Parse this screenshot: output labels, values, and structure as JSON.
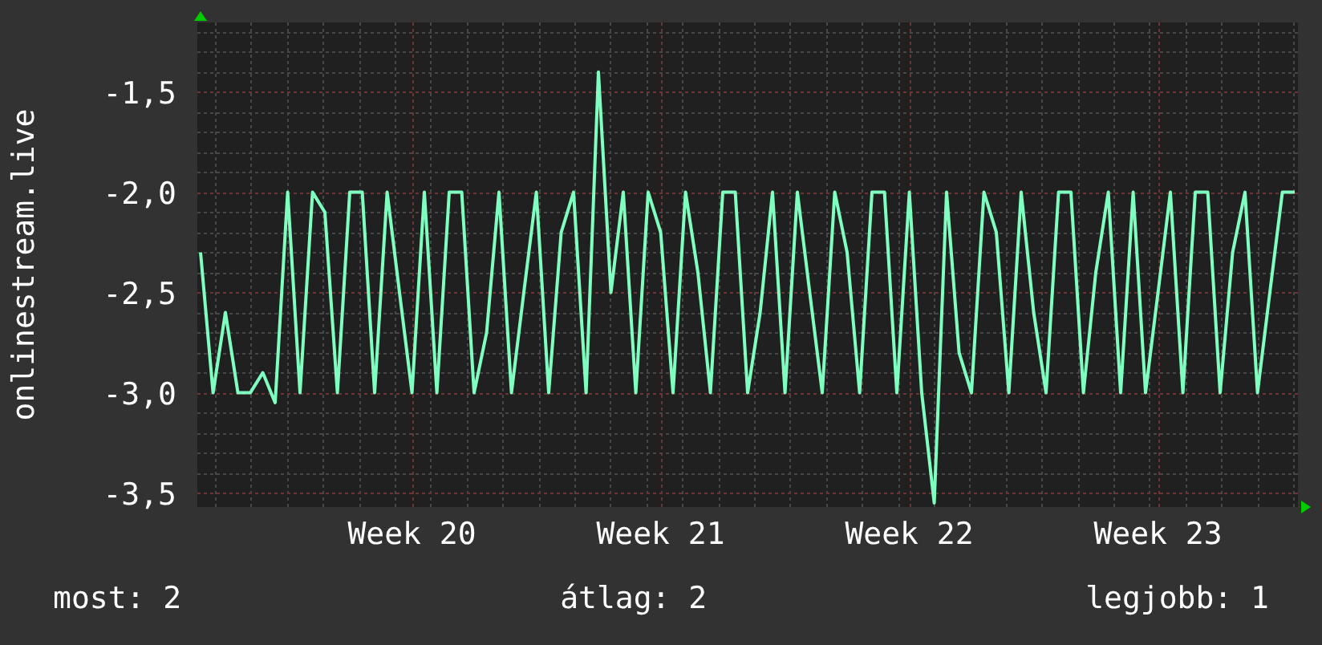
{
  "chart_data": {
    "type": "line",
    "grid": true,
    "ylabel": "onlinestream.live",
    "categories": [
      null,
      null,
      null,
      null,
      null,
      null,
      null,
      null,
      null,
      null,
      null,
      null,
      null,
      null,
      null,
      null,
      null,
      "Week 20",
      null,
      null,
      null,
      null,
      null,
      null,
      null,
      null,
      null,
      null,
      null,
      null,
      null,
      null,
      null,
      null,
      null,
      null,
      null,
      "Week 21",
      null,
      null,
      null,
      null,
      null,
      null,
      null,
      null,
      null,
      null,
      null,
      null,
      null,
      null,
      null,
      null,
      null,
      null,
      null,
      "Week 22",
      null,
      null,
      null,
      null,
      null,
      null,
      null,
      null,
      null,
      null,
      null,
      null,
      null,
      null,
      null,
      null,
      null,
      null,
      null,
      "Week 23",
      null,
      null,
      null,
      null,
      null,
      null,
      null,
      null,
      null,
      null,
      null
    ],
    "series": [
      {
        "color": "#7fffbf",
        "values": [
          -2.3,
          -3.0,
          -2.6,
          -3.0,
          -3.0,
          -2.9,
          -3.05,
          -2.0,
          -3.0,
          -2.0,
          -2.1,
          -3.0,
          -2.0,
          -2.0,
          -3.0,
          -2.0,
          -2.5,
          -3.0,
          -2.0,
          -3.0,
          -2.0,
          -2.0,
          -3.0,
          -2.7,
          -2.0,
          -3.0,
          -2.5,
          -2.0,
          -3.0,
          -2.2,
          -2.0,
          -3.0,
          -1.4,
          -2.5,
          -2.0,
          -3.0,
          -2.0,
          -2.2,
          -3.0,
          -2.0,
          -2.4,
          -3.0,
          -2.0,
          -2.0,
          -3.0,
          -2.6,
          -2.0,
          -3.0,
          -2.0,
          -2.5,
          -3.0,
          -2.0,
          -2.3,
          -3.0,
          -2.0,
          -2.0,
          -3.0,
          -2.0,
          -3.0,
          -3.55,
          -2.0,
          -2.8,
          -3.0,
          -2.0,
          -2.2,
          -3.0,
          -2.0,
          -2.6,
          -3.0,
          -2.0,
          -2.0,
          -3.0,
          -2.4,
          -2.0,
          -3.0,
          -2.0,
          -3.0,
          -2.5,
          -2.0,
          -3.0,
          -2.0,
          -2.0,
          -3.0,
          -2.3,
          -2.0,
          -3.0,
          -2.5,
          -2.0,
          -2.0
        ]
      }
    ],
    "ylim": [
      -3.57,
      -1.153
    ],
    "yticks": [
      {
        "value": -1.5,
        "label": "-1,5"
      },
      {
        "value": -2,
        "label": "-2,0"
      },
      {
        "value": -2.5,
        "label": "-2,5"
      },
      {
        "value": -3,
        "label": "-3,0"
      },
      {
        "value": -3.5,
        "label": "-3,5"
      }
    ]
  },
  "footer": [
    {
      "label": "most: 2"
    },
    {
      "label": "átlag: 2"
    },
    {
      "label": "legjobb: 1"
    }
  ]
}
